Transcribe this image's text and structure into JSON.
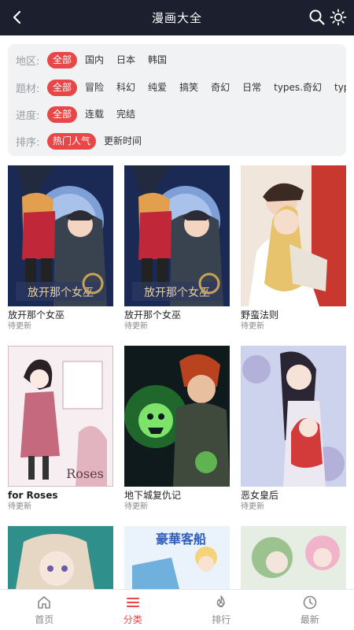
{
  "header": {
    "title": "漫画大全"
  },
  "filters": [
    {
      "label": "地区:",
      "options": [
        "全部",
        "国内",
        "日本",
        "韩国"
      ],
      "active": 0
    },
    {
      "label": "题材:",
      "options": [
        "全部",
        "冒险",
        "科幻",
        "纯爱",
        "搞笑",
        "奇幻",
        "日常",
        "types.奇幻",
        "types.校"
      ],
      "active": 0
    },
    {
      "label": "进度:",
      "options": [
        "全部",
        "连载",
        "完结"
      ],
      "active": 0
    },
    {
      "label": "排序:",
      "options": [
        "热门人气",
        "更新时间"
      ],
      "active": 0
    }
  ],
  "comics": [
    {
      "title": "放开那个女巫",
      "status": "待更新"
    },
    {
      "title": "放开那个女巫",
      "status": "待更新"
    },
    {
      "title": "野蛮法则",
      "status": "待更新"
    },
    {
      "title": "for Roses",
      "status": "待更新"
    },
    {
      "title": "地下城复仇记",
      "status": "待更新"
    },
    {
      "title": "恶女皇后",
      "status": "待更新"
    }
  ],
  "tabs": [
    {
      "label": "首页",
      "icon": "home-icon"
    },
    {
      "label": "分类",
      "icon": "list-icon"
    },
    {
      "label": "排行",
      "icon": "fire-icon"
    },
    {
      "label": "最新",
      "icon": "clock-icon"
    }
  ],
  "active_tab": 1,
  "colors": {
    "header_bg": "#1c1f2e",
    "accent": "#e94747"
  }
}
